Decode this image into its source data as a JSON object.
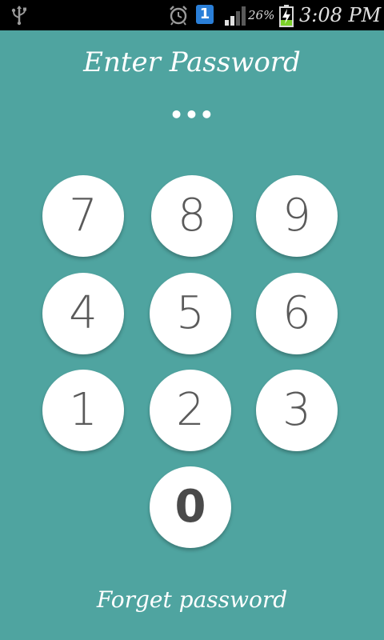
{
  "status_bar": {
    "notification_count": "1",
    "battery_percent": "26%",
    "time": "3:08 PM",
    "icons": [
      "usb-icon",
      "alarm-clock-icon",
      "notification-badge-icon",
      "signal-strength-icon",
      "battery-charging-icon"
    ]
  },
  "lock": {
    "title": "Enter Password",
    "entered_mask": "•••",
    "forget_label": "Forget password"
  },
  "keypad": {
    "keys": [
      "7",
      "8",
      "9",
      "4",
      "5",
      "6",
      "1",
      "2",
      "3",
      "0"
    ]
  },
  "colors": {
    "background": "#4fa4a0",
    "key_fill": "#ffffff",
    "digit": "#5a5a5a",
    "status_bar": "#000000"
  }
}
